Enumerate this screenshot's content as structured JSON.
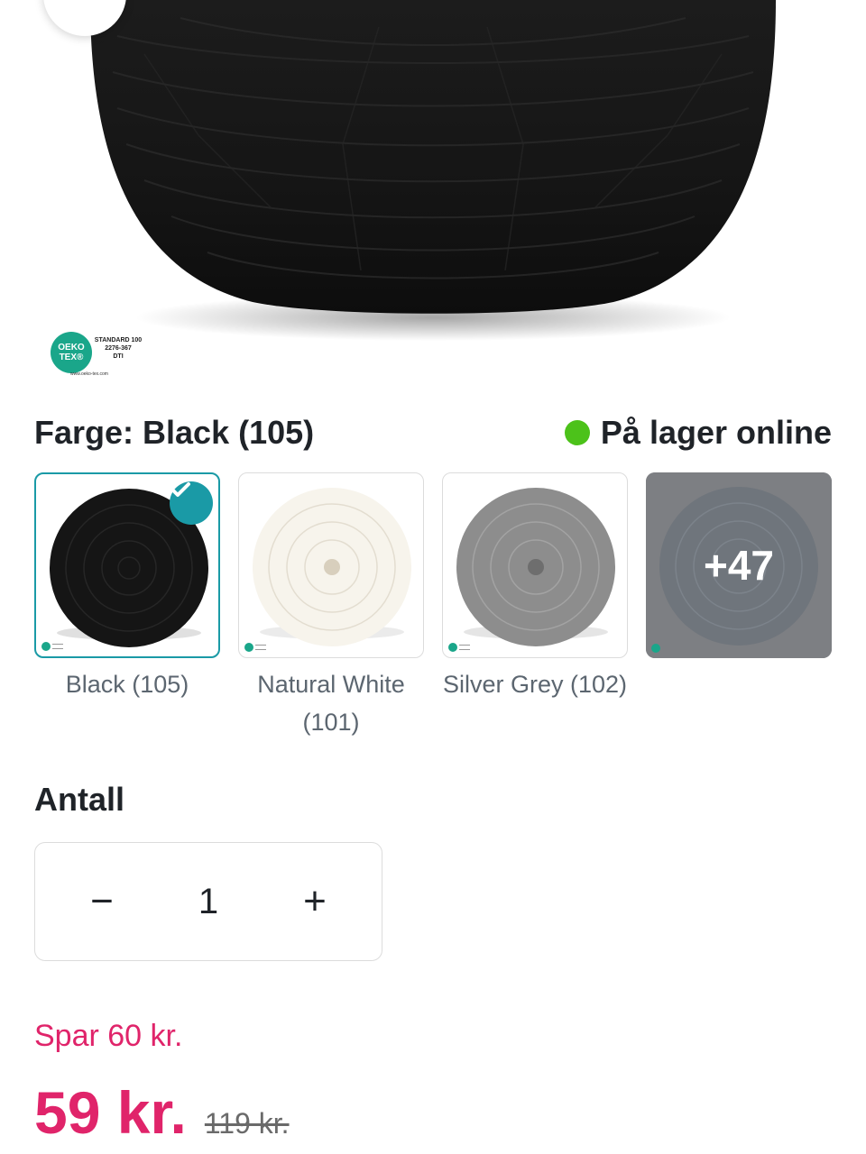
{
  "hero": {
    "back_icon": "chevron-left-icon",
    "oeko_badge": {
      "logo": "OEKO TEX®",
      "standard": "STANDARD 100",
      "code": "2276-367",
      "institute": "DTI",
      "url": "www.oeko-tex.com"
    }
  },
  "color": {
    "title": "Farge: Black (105)",
    "stock_label": "På lager online",
    "stock_color": "#4cc21a"
  },
  "swatches": [
    {
      "label": "Black (105)",
      "selected": true,
      "yarn_color": "#151515"
    },
    {
      "label": "Natural White (101)",
      "selected": false,
      "yarn_color": "#f7f4ec"
    },
    {
      "label": "Silver Grey (102)",
      "selected": false,
      "yarn_color": "#8d8d8d"
    },
    {
      "label": "",
      "more_count": "+47",
      "yarn_color": "#6f757c"
    }
  ],
  "quantity": {
    "title": "Antall",
    "value": "1",
    "decrement": "−",
    "increment": "+"
  },
  "price": {
    "savings": "Spar 60 kr.",
    "current": "59 kr.",
    "original": "119 kr.",
    "accent_color": "#e0246a"
  }
}
